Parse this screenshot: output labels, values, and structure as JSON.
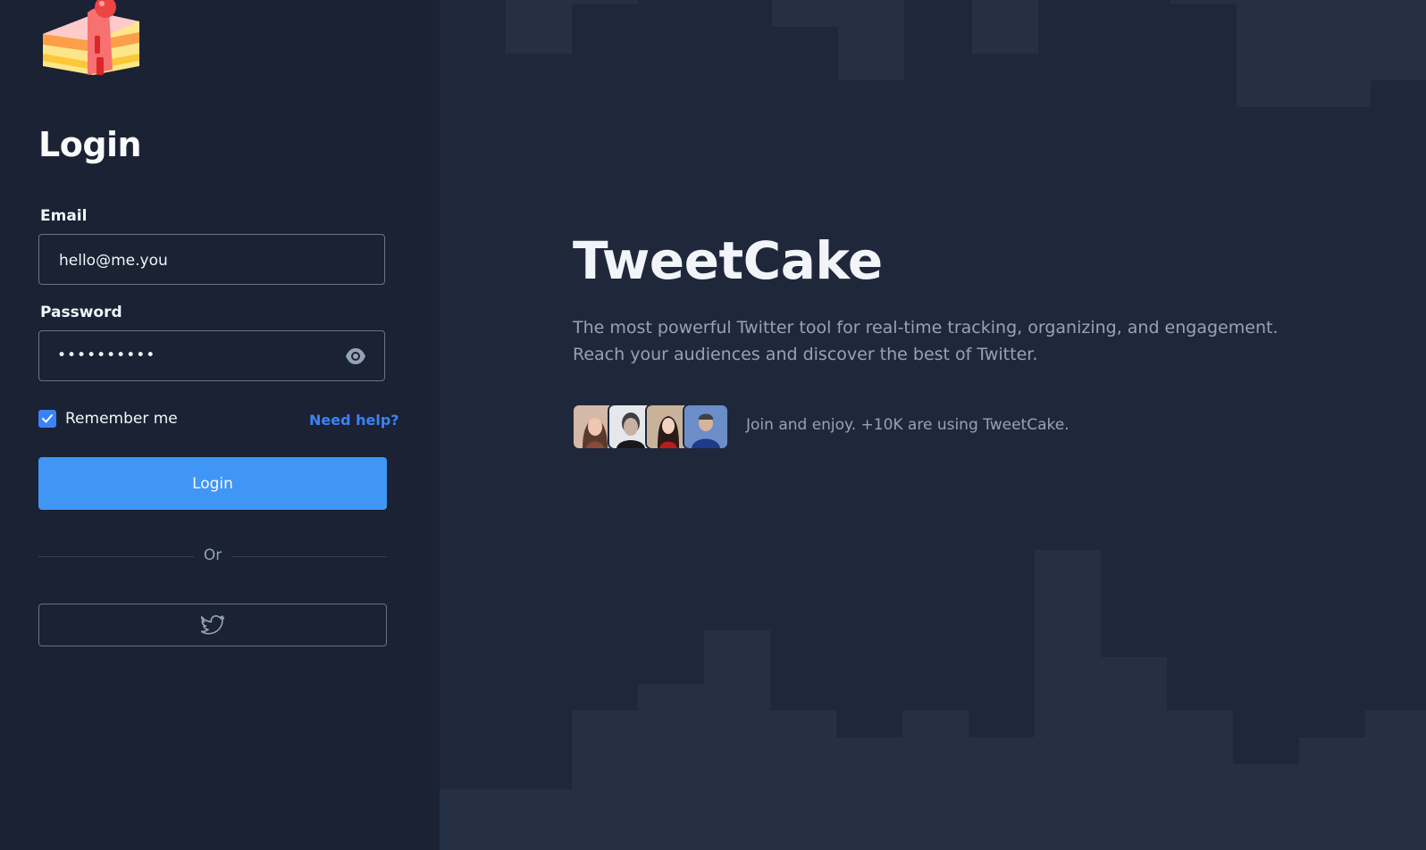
{
  "login": {
    "title": "Login",
    "email_label": "Email",
    "email_value": "hello@me.you",
    "password_label": "Password",
    "password_value": "••••••••••",
    "remember_label": "Remember me",
    "remember_checked": true,
    "help_link": "Need help?",
    "login_button": "Login",
    "divider_text": "Or",
    "social_icon": "twitter-bird-icon"
  },
  "hero": {
    "brand": "TweetCake",
    "tagline": "The most powerful Twitter tool for real-time tracking, organizing, and engagement. Reach your audiences and discover the best of Twitter.",
    "social_proof": "Join and enjoy. +10K are using TweetCake."
  },
  "colors": {
    "accent": "#3b82f6",
    "button": "#4096f4",
    "left_bg": "#1a2233",
    "right_bg": "#1f283b"
  }
}
